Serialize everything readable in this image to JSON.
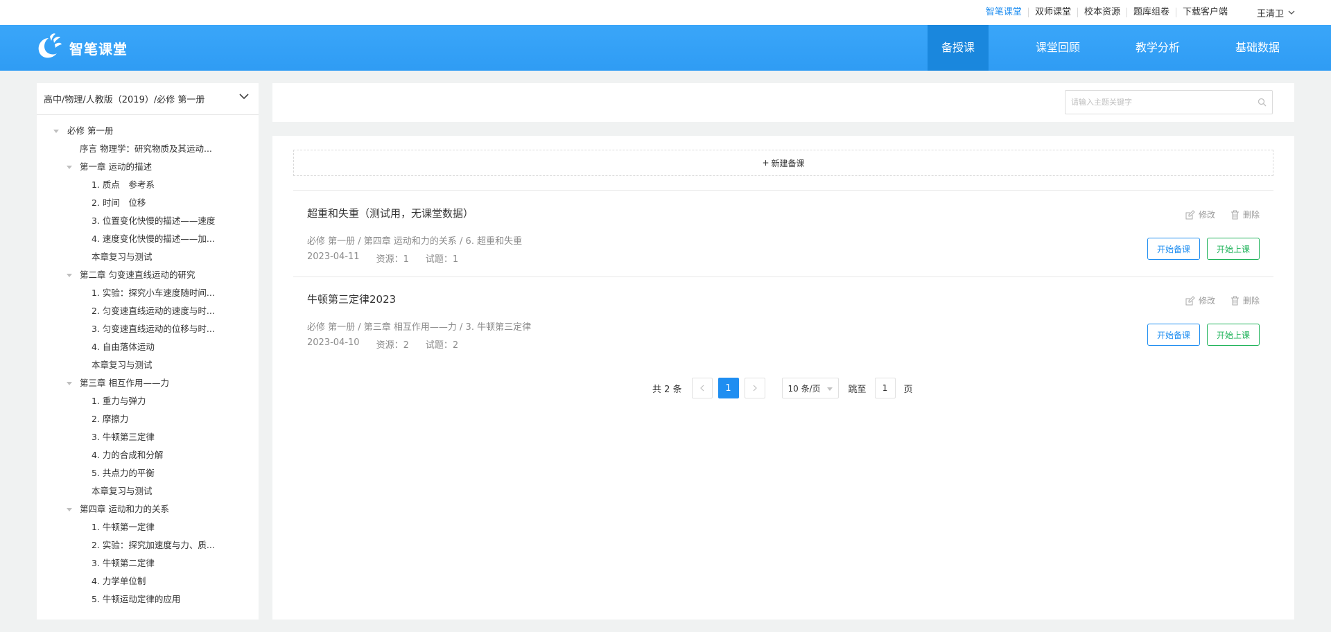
{
  "toplinks": [
    {
      "label": "智笔课堂",
      "active": true
    },
    {
      "label": "双师课堂",
      "active": false
    },
    {
      "label": "校本资源",
      "active": false
    },
    {
      "label": "题库组卷",
      "active": false
    },
    {
      "label": "下载客户端",
      "active": false
    }
  ],
  "user": {
    "name": "王清卫"
  },
  "logo": {
    "text": "智笔课堂"
  },
  "nav": [
    {
      "label": "备授课",
      "active": true
    },
    {
      "label": "课堂回顾",
      "active": false
    },
    {
      "label": "教学分析",
      "active": false
    },
    {
      "label": "基础数据",
      "active": false
    }
  ],
  "sidebar": {
    "selector": "高中/物理/人教版（2019）/必修 第一册",
    "tree": [
      {
        "label": "必修 第一册",
        "level": 0,
        "caret": true
      },
      {
        "label": "序言 物理学：研究物质及其运动...",
        "level": 1,
        "caret": false
      },
      {
        "label": "第一章 运动的描述",
        "level": 1,
        "caret": true
      },
      {
        "label": "1. 质点　参考系",
        "level": 2,
        "caret": false
      },
      {
        "label": "2. 时间　位移",
        "level": 2,
        "caret": false
      },
      {
        "label": "3. 位置变化快慢的描述——速度",
        "level": 2,
        "caret": false
      },
      {
        "label": "4. 速度变化快慢的描述——加...",
        "level": 2,
        "caret": false
      },
      {
        "label": "本章复习与测试",
        "level": 2,
        "caret": false
      },
      {
        "label": "第二章 匀变速直线运动的研究",
        "level": 1,
        "caret": true
      },
      {
        "label": "1. 实验：探究小车速度随时间...",
        "level": 2,
        "caret": false
      },
      {
        "label": "2. 匀变速直线运动的速度与时...",
        "level": 2,
        "caret": false
      },
      {
        "label": "3. 匀变速直线运动的位移与时...",
        "level": 2,
        "caret": false
      },
      {
        "label": "4. 自由落体运动",
        "level": 2,
        "caret": false
      },
      {
        "label": "本章复习与测试",
        "level": 2,
        "caret": false
      },
      {
        "label": "第三章 相互作用——力",
        "level": 1,
        "caret": true
      },
      {
        "label": "1. 重力与弹力",
        "level": 2,
        "caret": false
      },
      {
        "label": "2. 摩擦力",
        "level": 2,
        "caret": false
      },
      {
        "label": "3. 牛顿第三定律",
        "level": 2,
        "caret": false
      },
      {
        "label": "4. 力的合成和分解",
        "level": 2,
        "caret": false
      },
      {
        "label": "5. 共点力的平衡",
        "level": 2,
        "caret": false
      },
      {
        "label": "本章复习与测试",
        "level": 2,
        "caret": false
      },
      {
        "label": "第四章 运动和力的关系",
        "level": 1,
        "caret": true
      },
      {
        "label": "1. 牛顿第一定律",
        "level": 2,
        "caret": false
      },
      {
        "label": "2. 实验：探究加速度与力、质...",
        "level": 2,
        "caret": false
      },
      {
        "label": "3. 牛顿第二定律",
        "level": 2,
        "caret": false
      },
      {
        "label": "4. 力学单位制",
        "level": 2,
        "caret": false
      },
      {
        "label": "5. 牛顿运动定律的应用",
        "level": 2,
        "caret": false
      }
    ]
  },
  "search": {
    "placeholder": "请输入主题关键字",
    "value": ""
  },
  "main": {
    "new_label": "新建备课",
    "edit_label": "修改",
    "delete_label": "删除",
    "prepare_label": "开始备课",
    "teach_label": "开始上课",
    "lessons": [
      {
        "title": "超重和失重（测试用，无课堂数据）",
        "path": "必修 第一册 / 第四章 运动和力的关系 / 6. 超重和失重",
        "date": "2023-04-11",
        "resources": "资源：1",
        "questions": "试题：1"
      },
      {
        "title": "牛顿第三定律2023",
        "path": "必修 第一册 / 第三章 相互作用——力 / 3. 牛顿第三定律",
        "date": "2023-04-10",
        "resources": "资源：2",
        "questions": "试题：2"
      }
    ]
  },
  "pager": {
    "total": "共 2 条",
    "current": "1",
    "size": "10 条/页",
    "jump_label": "跳至",
    "jump_value": "1",
    "page_label": "页"
  }
}
